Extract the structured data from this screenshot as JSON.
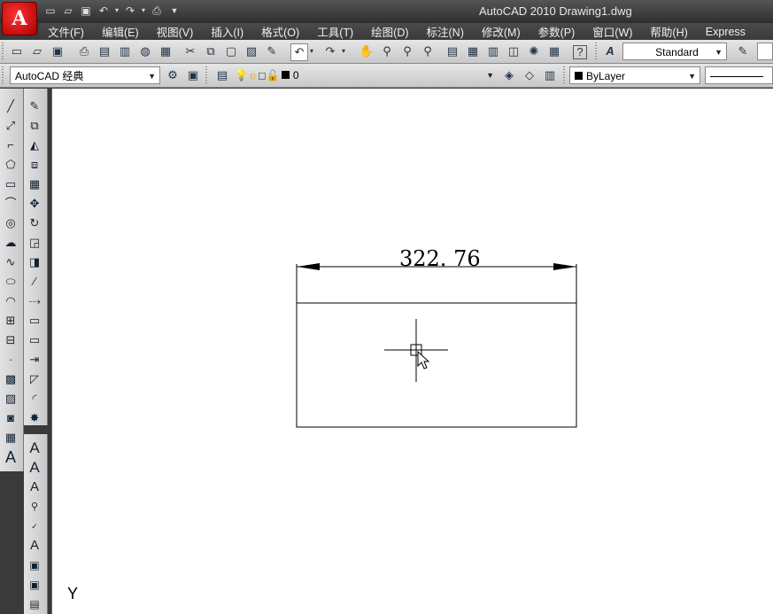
{
  "app": {
    "logo_letter": "A",
    "title": "AutoCAD 2010    Drawing1.dwg"
  },
  "menu": [
    "文件(F)",
    "编辑(E)",
    "视图(V)",
    "插入(I)",
    "格式(O)",
    "工具(T)",
    "绘图(D)",
    "标注(N)",
    "修改(M)",
    "参数(P)",
    "窗口(W)",
    "帮助(H)",
    "Express"
  ],
  "toolbar1": {
    "text_style": "Standard"
  },
  "toolbar2": {
    "workspace": "AutoCAD 经典",
    "layer": "0",
    "color": "ByLayer"
  },
  "drawing": {
    "dimension_value": "322. 76",
    "ucs_label": "Y"
  },
  "colors": {
    "title_bg": "#3a3a3a",
    "toolbar_bg": "#d4d4d4",
    "canvas_bg": "#ffffff"
  }
}
